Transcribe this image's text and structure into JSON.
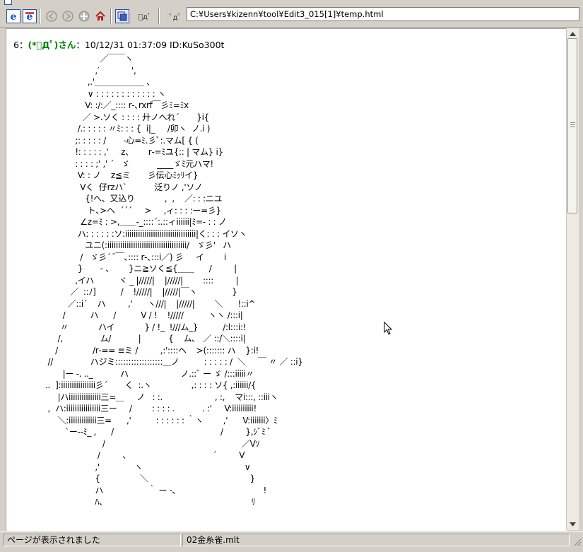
{
  "toolbar": {
    "buttons": [
      {
        "name": "ie-button-1",
        "icon": "ie-e-icon"
      },
      {
        "name": "ie-button-2",
        "icon": "ie-e-red-icon"
      },
      {
        "name": "back-button",
        "icon": "back-arrow-icon"
      },
      {
        "name": "forward-button",
        "icon": "forward-arrow-icon"
      },
      {
        "name": "stop-button",
        "icon": "stop-icon"
      },
      {
        "name": "home-button",
        "icon": "home-icon"
      },
      {
        "name": "copy-button",
        "icon": "window-copy-icon"
      },
      {
        "name": "face-button",
        "icon": "face-icon"
      },
      {
        "name": "bookmark-button",
        "icon": "bookmark-icon"
      }
    ],
    "address": "C:¥Users¥kizenn¥tool¥Edit3_015[1]¥temp.html"
  },
  "post": {
    "number": "6",
    "separator": "：",
    "name": "(*ﾟДﾟ)さん",
    "date_id": "：10/12/31 01:37:09 ID:KuSo300t"
  },
  "ascii_art": "                        ／￣￣ヽ\n                      ,′             ',\n                   ,.'＿＿＿＿＿＿ ､\n                   ∨ : : : : : : : : : : : : ヽ\n                  V: :/:／_:::: r‐､rxrf￣彡ﾐ=ﾐx\n                 ／ >.ソく : : : : 廾ノへれ´       }i{\n               /.: : : : : 〃ﾐ: : : {  i|_     /卯ヽ  ノ.i )\n              ;: : : : : /       ‐心=ﾐ.彡ﾞ:.マム[ { (\n              !: : : : : ,'     z、      r‐=ﾐユ{:: | マム} i}\n              : : : : ;' ,' ´   ゞ           ____ゞﾐ元ハマ!\n               V: : ノ    z≦ミ       彡伝心ﾐｯﾘイ}\n                Vく  仔rzハ`           泛りノ ,'ソノ\n                  {!へ、又込り            ,  ,    ／: : :ニユ\n                   ト､>ヘ  ´´´     >     ,ィ: : : :ー=彡}\n                ∠z=ﾐ : >,＿＿‐_::::´:.::ィiiiiii|ﾐ=‐ : : ノ\n               ハ: : : : : :ソ:iiiiiiiiiiiiiiiiiiiiiiiiiiiiiiiii|く: : : イソヽ\n                  ユニ(:iiiiiiiiiiiiiiiiiiiiiiiiiiiiiiiiiiiii/   ゞ彡'   ハ\n                /   ゞ彡´  ̄￣､:::: r‐､:::i／) 彡     イ        i\n               }       ‐ 、      }ニ≧ソく≦{＿＿      /         |\n              ,イハ          ヾ _ |/////|    |/////|        ::::         |\n            ／  ::ﾉ]          /    !/////|    |/////|￣ヽ              }\n           ／::i´    ハ         ,'      ヽ///|    |/////|        ＼      !::i^\n         /          ハ      /          V / !    !/////          ヽヽ /:::i|\n        〃            ハイ            } / !_  !///ム_}          /:l:::i:!\n       /,               ム/           |           {    ム､   ／ ::/＼::::i|\n      /              /r‐== ≡ミ /         ,:'::::ヘ    >(::::::: ハ    }:i!\n   //               ハジミ::::::::::::::::::＿ノ          : : : : : /  ＼     ￣ 〃 ／ ::i}\n         |ー -. .._           ハ                     ノ.::ﾞ ー ゞ /:::iiiii〃\n  ..  ]:iiiiiiiiiiiiiiii彡´       く  :.ヽ                ,: : : : ソ{ ,:iiiiii/{\n       |ハiiiiiiiiiiiiiii三=＿     ノ   : :.                     , :,    マi:::, ::iiiヽ\n   ,  ハ:iiiiiiiiiiiiiiii三ー     /        : : : : .           . :'     V:iiiiiiiiii!\n       ＼:iiiiiiiiiiiii三=      ,'          : : : : : : ｀ヽ        ,'      V:iiiiiii〉ﾐ\n          `ー--ﾐ_ ,      /                                           /         },ｼﾞﾐ ﾞ\n                         /                                                       ／Vｿ\n                       /         、                                 ´         V\n                      ,'              ヽ                                         ∨\n                      {                ＼                                         }\n                      ハ                  ｀ ー ‐､                                   !\n                      ﾊ、                                                          ﾘ",
  "status": {
    "message": "ページが表示されました",
    "file": "02金糸雀.mlt"
  },
  "colors": {
    "chrome": "#d4d0c8",
    "name_green": "#008000",
    "ie_blue": "#1a4fd8"
  }
}
